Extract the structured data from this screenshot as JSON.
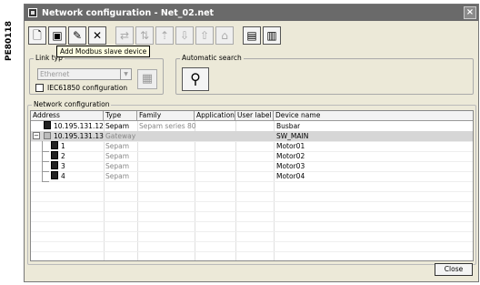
{
  "side_label": "PE80118",
  "window": {
    "title": "Network configuration - Net_02.net",
    "close_glyph": "×"
  },
  "tooltip": "Add Modbus slave device",
  "link_type": {
    "legend": "Link typ",
    "selected": "Ethernet",
    "iec_label": "IEC61850 configuration"
  },
  "auto_search": {
    "legend": "Automatic search"
  },
  "network": {
    "legend": "Network configuration",
    "columns": [
      "Address",
      "Type",
      "Family",
      "Application",
      "User label",
      "Device name"
    ],
    "rows": [
      {
        "address": "10.195.131.12",
        "type": "Sepam",
        "family": "Sepam series 80",
        "application": "",
        "user_label": "",
        "device": "Busbar"
      },
      {
        "address": "10.195.131.13",
        "type": "Gateway",
        "family": "",
        "application": "",
        "user_label": "",
        "device": "SW_MAIN"
      },
      {
        "address": "1",
        "type": "Sepam",
        "family": "",
        "application": "",
        "user_label": "",
        "device": "Motor01"
      },
      {
        "address": "2",
        "type": "Sepam",
        "family": "",
        "application": "",
        "user_label": "",
        "device": "Motor02"
      },
      {
        "address": "3",
        "type": "Sepam",
        "family": "",
        "application": "",
        "user_label": "",
        "device": "Motor03"
      },
      {
        "address": "4",
        "type": "Sepam",
        "family": "",
        "application": "",
        "user_label": "",
        "device": "Motor04"
      }
    ]
  },
  "close_button": "Close"
}
